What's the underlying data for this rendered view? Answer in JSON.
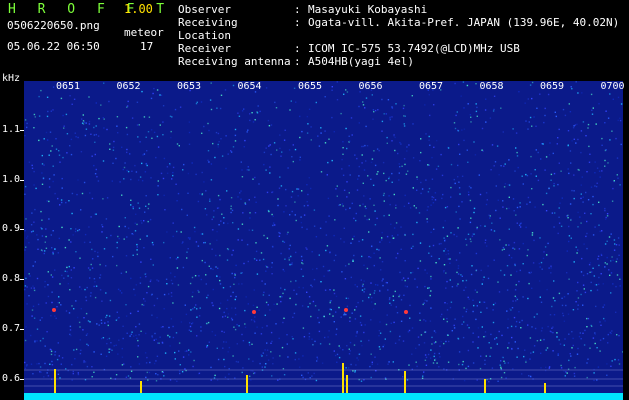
{
  "app": {
    "logo": "H R O F F T",
    "version": "1.00",
    "filename": "0506220650.png",
    "datetime": "05.06.22 06:50",
    "counter_label": "meteor",
    "counter_value": "17"
  },
  "info": [
    {
      "key": "Observer",
      "value": "Masayuki Kobayashi"
    },
    {
      "key": "Receiving Location",
      "value": "Ogata-vill. Akita-Pref. JAPAN (139.96E, 40.02N)"
    },
    {
      "key": "Receiver",
      "value": "ICOM IC-575 53.7492(@LCD)MHz USB"
    },
    {
      "key": "Receiving antenna",
      "value": "A504HB(yagi 4el)"
    }
  ],
  "axis": {
    "y_unit": "kHz",
    "y_ticks": [
      "1.1",
      "1.0",
      "0.9",
      "0.8",
      "0.7",
      "0.6"
    ],
    "x_ticks": [
      "0651",
      "0652",
      "0653",
      "0654",
      "0655",
      "0656",
      "0657",
      "0658",
      "0659",
      "0700"
    ]
  },
  "colors": {
    "background": "#000000",
    "spectrum": "#0b1a8a",
    "logo": "#7dff3a",
    "version": "#ffe000",
    "baseline": "#00e5ff",
    "spike": "#ffe000"
  }
}
